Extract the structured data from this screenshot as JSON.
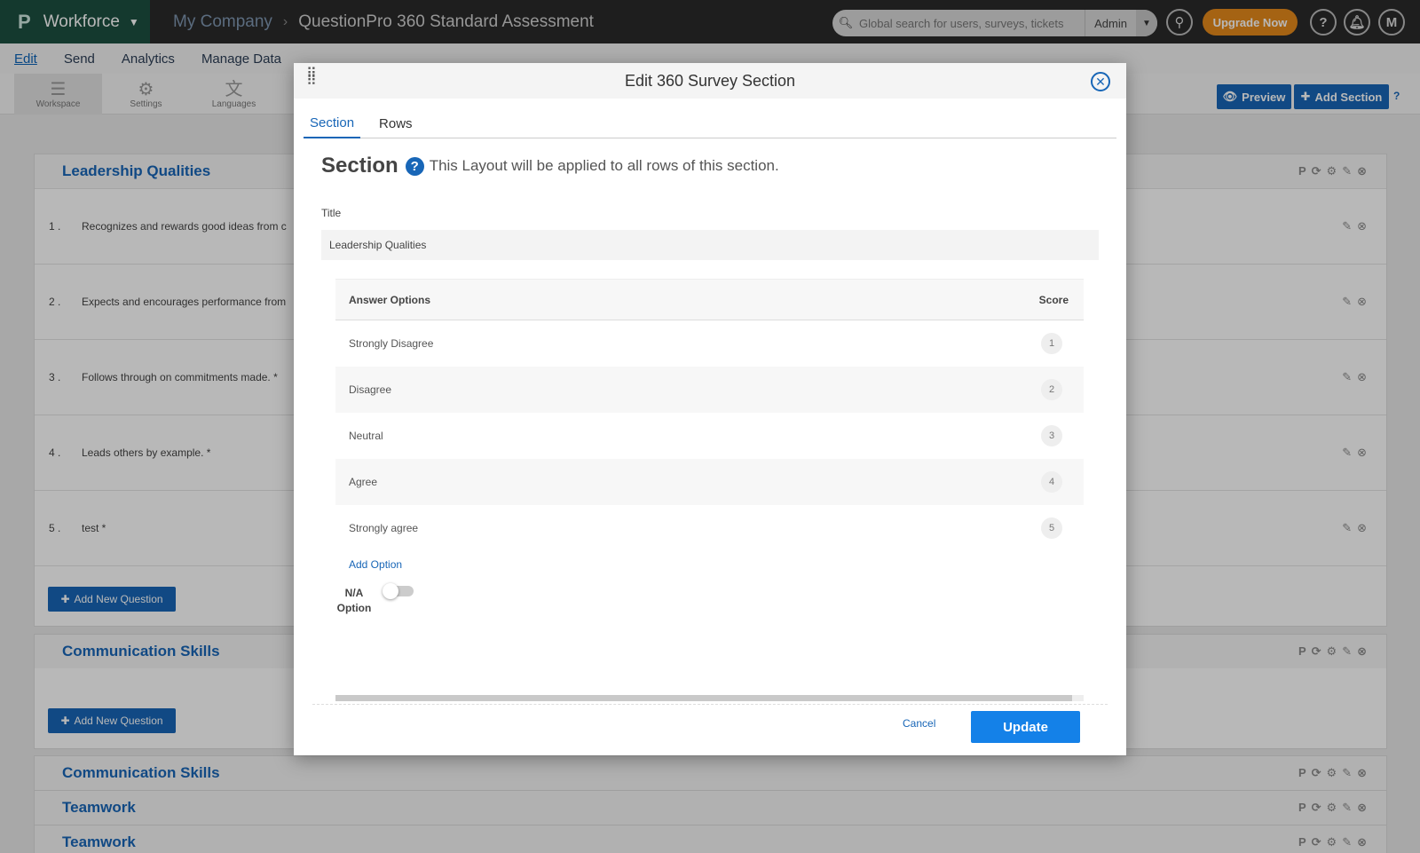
{
  "topbar": {
    "logo": "P",
    "product": "Workforce",
    "company": "My Company",
    "survey_title": "QuestionPro 360 Standard Assessment",
    "search_placeholder": "Global search for users, surveys, tickets",
    "role": "Admin",
    "upgrade_label": "Upgrade Now",
    "help_glyph": "?",
    "avatar_initial": "M"
  },
  "menu": [
    "Edit",
    "Send",
    "Analytics",
    "Manage Data"
  ],
  "toolbar": {
    "tools": [
      {
        "label": "Workspace",
        "icon": "list-icon"
      },
      {
        "label": "Settings",
        "icon": "gear-icon"
      },
      {
        "label": "Languages",
        "icon": "translate-icon"
      }
    ],
    "preview_label": "Preview",
    "add_section_label": "Add Section"
  },
  "background": {
    "section1": {
      "title": "Leadership Qualities",
      "questions": [
        {
          "num": "1 .",
          "text": "Recognizes and rewards good ideas from c"
        },
        {
          "num": "2 .",
          "text": "Expects and encourages performance from"
        },
        {
          "num": "3 .",
          "text": "Follows through on commitments made. *"
        },
        {
          "num": "4 .",
          "text": "Leads others by example. *"
        },
        {
          "num": "5 .",
          "text": "test *"
        }
      ],
      "add_question_label": "Add New Question"
    },
    "section2": {
      "title": "Communication Skills",
      "add_question_label": "Add New Question"
    },
    "section3": {
      "title": "Communication Skills"
    },
    "section4": {
      "title": "Teamwork"
    },
    "section5": {
      "title": "Teamwork"
    }
  },
  "modal": {
    "title": "Edit 360 Survey Section",
    "tabs": [
      "Section",
      "Rows"
    ],
    "section_heading": "Section",
    "section_note": "This Layout will be applied to all rows of this section.",
    "title_label": "Title",
    "title_value": "Leadership Qualities",
    "table_headers": {
      "options": "Answer Options",
      "score": "Score"
    },
    "answer_options": [
      {
        "label": "Strongly Disagree",
        "score": "1"
      },
      {
        "label": "Disagree",
        "score": "2"
      },
      {
        "label": "Neutral",
        "score": "3"
      },
      {
        "label": "Agree",
        "score": "4"
      },
      {
        "label": "Strongly agree",
        "score": "5"
      }
    ],
    "add_option_label": "Add Option",
    "na_label_line1": "N/A",
    "na_label_line2": "Option",
    "na_enabled": false,
    "cancel_label": "Cancel",
    "update_label": "Update"
  },
  "colors": {
    "accent": "#1866b7",
    "brand_green": "#1d4f40",
    "upgrade": "#e5891b",
    "update": "#1481e8"
  }
}
